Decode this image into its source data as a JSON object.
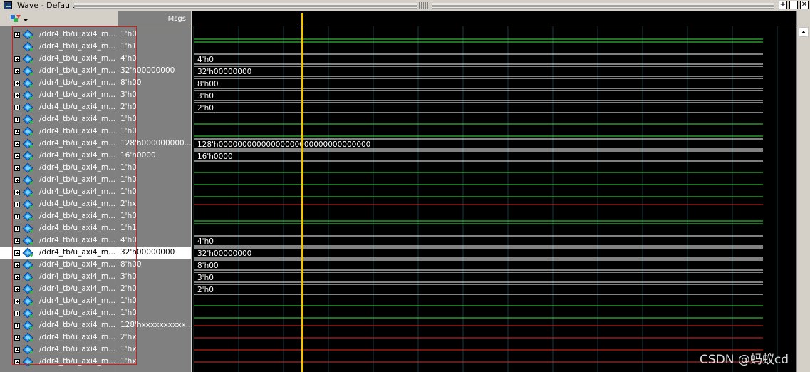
{
  "window": {
    "title": "Wave - Default"
  },
  "header": {
    "msgs_label": "Msgs"
  },
  "colors": {
    "green_wave": "#3ee43e",
    "red_wave": "#e02828",
    "bus_wave": "#ffffff",
    "cursor": "#f5c400",
    "grid": "#2b6a7a",
    "highlight": "#d71a1a"
  },
  "signals": [
    {
      "name": "/ddr4_tb/u_axi4_m...",
      "value": "1'h0",
      "kind": "bit0"
    },
    {
      "name": "/ddr4_tb/u_axi4_m...",
      "value": "1'h1",
      "kind": "bit1",
      "noexpand": true
    },
    {
      "name": "/ddr4_tb/u_axi4_m...",
      "value": "4'h0",
      "kind": "bus",
      "wave_label": "4'h0"
    },
    {
      "name": "/ddr4_tb/u_axi4_m...",
      "value": "32'h00000000",
      "kind": "bus",
      "wave_label": "32'h00000000"
    },
    {
      "name": "/ddr4_tb/u_axi4_m...",
      "value": "8'h00",
      "kind": "bus",
      "wave_label": "8'h00"
    },
    {
      "name": "/ddr4_tb/u_axi4_m...",
      "value": "3'h0",
      "kind": "bus",
      "wave_label": "3'h0"
    },
    {
      "name": "/ddr4_tb/u_axi4_m...",
      "value": "2'h0",
      "kind": "bus",
      "wave_label": "2'h0"
    },
    {
      "name": "/ddr4_tb/u_axi4_m...",
      "value": "1'h0",
      "kind": "bit0"
    },
    {
      "name": "/ddr4_tb/u_axi4_m...",
      "value": "1'h0",
      "kind": "bit0"
    },
    {
      "name": "/ddr4_tb/u_axi4_m...",
      "value": "128'h000000000...",
      "kind": "bus",
      "wave_label": "128'h00000000000000000000000000000000"
    },
    {
      "name": "/ddr4_tb/u_axi4_m...",
      "value": "16'h0000",
      "kind": "bus",
      "wave_label": "16'h0000"
    },
    {
      "name": "/ddr4_tb/u_axi4_m...",
      "value": "1'h0",
      "kind": "bit0"
    },
    {
      "name": "/ddr4_tb/u_axi4_m...",
      "value": "1'h0",
      "kind": "bit0"
    },
    {
      "name": "/ddr4_tb/u_axi4_m...",
      "value": "1'h0",
      "kind": "bit0"
    },
    {
      "name": "/ddr4_tb/u_axi4_m...",
      "value": "2'hx",
      "kind": "x"
    },
    {
      "name": "/ddr4_tb/u_axi4_m...",
      "value": "1'h0",
      "kind": "bit0"
    },
    {
      "name": "/ddr4_tb/u_axi4_m...",
      "value": "1'h1",
      "kind": "bit1"
    },
    {
      "name": "/ddr4_tb/u_axi4_m...",
      "value": "4'h0",
      "kind": "bus",
      "wave_label": "4'h0"
    },
    {
      "name": "/ddr4_tb/u_axi4_m...",
      "value": "32'h00000000",
      "kind": "bus",
      "wave_label": "32'h00000000",
      "selected": true
    },
    {
      "name": "/ddr4_tb/u_axi4_m...",
      "value": "8'h00",
      "kind": "bus",
      "wave_label": "8'h00"
    },
    {
      "name": "/ddr4_tb/u_axi4_m...",
      "value": "3'h0",
      "kind": "bus",
      "wave_label": "3'h0"
    },
    {
      "name": "/ddr4_tb/u_axi4_m...",
      "value": "2'h0",
      "kind": "bus",
      "wave_label": "2'h0"
    },
    {
      "name": "/ddr4_tb/u_axi4_m...",
      "value": "1'h0",
      "kind": "bit0"
    },
    {
      "name": "/ddr4_tb/u_axi4_m...",
      "value": "1'h0",
      "kind": "bit0"
    },
    {
      "name": "/ddr4_tb/u_axi4_m...",
      "value": "128'hxxxxxxxxxx...",
      "kind": "x"
    },
    {
      "name": "/ddr4_tb/u_axi4_m...",
      "value": "2'hx",
      "kind": "x"
    },
    {
      "name": "/ddr4_tb/u_axi4_m...",
      "value": "1'hx",
      "kind": "x"
    },
    {
      "name": "/ddr4_tb/u_axi4_m...",
      "value": "1'hx",
      "kind": "x"
    }
  ],
  "watermark": "CSDN @蚂蚁cd"
}
